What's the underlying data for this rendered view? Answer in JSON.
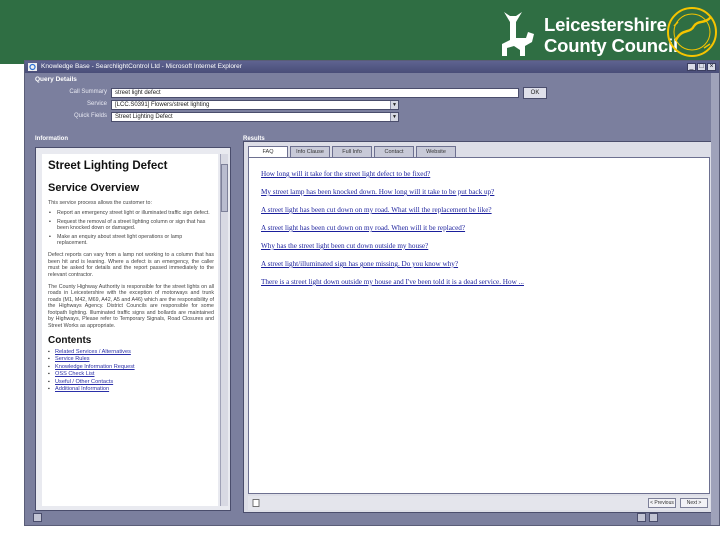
{
  "header": {
    "org_line1": "Leicestershire",
    "org_line2": "County Council",
    "seal_text": "RATED AS Excellent BY COUNCIL",
    "band_color": "#2f6e43"
  },
  "window": {
    "title": "Knowledge Base - SearchlightControl Ltd - Microsoft Internet Explorer"
  },
  "query": {
    "section_label": "Query Details",
    "customer_label": "Call Summary",
    "customer_value": "street light defect",
    "service_label": "Service",
    "service_value": "[LCC.S0391] Flowers/street lighting",
    "quicklist_label": "Quick Fields",
    "quicklist_value": "Street Lighting Defect",
    "ok_label": "OK"
  },
  "information": {
    "section_label": "Information",
    "title": "Street Lighting Defect",
    "overview_heading": "Service Overview",
    "intro": "This service process allows the customer to:",
    "bullets": [
      "Report an emergency street light or illuminated traffic sign defect.",
      "Request the removal of a street lighting column or sign that has been knocked down or damaged.",
      "Make an enquiry about street light operations or lamp replacement."
    ],
    "para1": "Defect reports can vary from a lamp not working to a column that has been hit and is leaning. Where a defect is an emergency, the caller must be asked for details and the report passed immediately to the relevant contractor.",
    "para2": "The County Highway Authority is responsible for the street lights on all roads in Leicestershire with the exception of motorways and trunk roads (M1, M42, M69, A42, A5 and A46) which are the responsibility of the Highways Agency. District Councils are responsible for some footpath lighting. Illuminated traffic signs and bollards are maintained by Highways, Please refer to Temporary Signals, Road Closures and Street Works as appropriate.",
    "contents_heading": "Contents",
    "contents": [
      "Related Services / Alternatives",
      "Service Rules",
      "Knowledge Information Request",
      "OSS Check List",
      "Useful / Other Contacts",
      "Additional Information"
    ]
  },
  "results": {
    "section_label": "Results",
    "tabs": [
      "FAQ",
      "Info Clause",
      "Full Info",
      "Contact",
      "Website"
    ],
    "links": [
      "How long will it take for the street light defect to be fixed?",
      "My street lamp has been knocked down. How long will it take to be put back up?",
      "A street light has been cut down on my road. What will the replacement be like?",
      "A street light has been cut down on my road. When will it be replaced?",
      "Why has the street light been cut down outside my house?",
      "A street light/illuminated sign has gone missing. Do you know why?",
      "There is a street light down outside my house and I've been told it is a dead service. How ..."
    ],
    "status_left": "",
    "btn_prev": "< Previous",
    "btn_next": "Next >"
  }
}
